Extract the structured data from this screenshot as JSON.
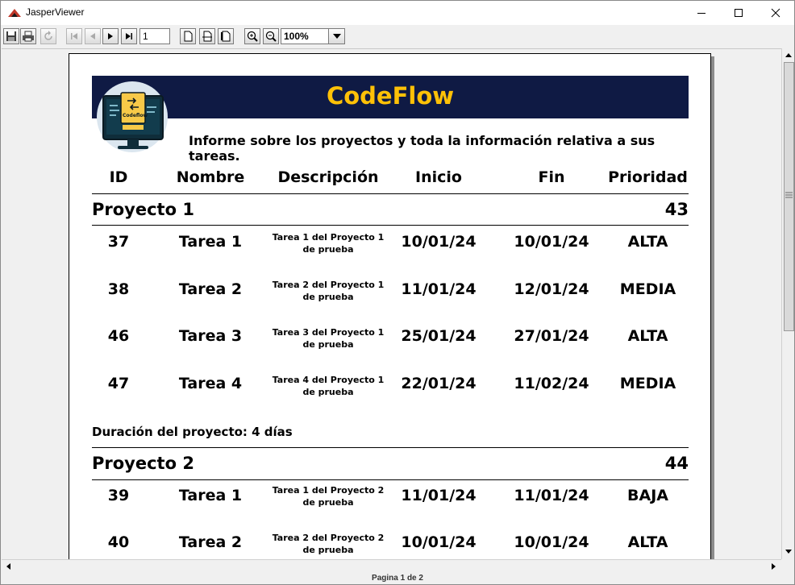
{
  "window": {
    "title": "JasperViewer"
  },
  "toolbar": {
    "page_number": "1",
    "zoom": "100%"
  },
  "status": {
    "page_label": "Pagina 1 de 2"
  },
  "report": {
    "brand": "CodeFlow",
    "logo_text": "Codeflow",
    "subtitle": "Informe sobre los proyectos y toda la información relativa a sus tareas.",
    "columns": [
      "ID",
      "Nombre",
      "Descripción",
      "Inicio",
      "Fin",
      "Prioridad"
    ],
    "projects": [
      {
        "name": "Proyecto 1",
        "id": "43",
        "duration": "Duración del proyecto: 4 días",
        "tasks": [
          {
            "id": "37",
            "name": "Tarea 1",
            "desc1": "Tarea 1 del Proyecto 1",
            "desc2": "de prueba",
            "start": "10/01/24",
            "end": "10/01/24",
            "priority": "ALTA"
          },
          {
            "id": "38",
            "name": "Tarea 2",
            "desc1": "Tarea 2 del Proyecto 1",
            "desc2": "de prueba",
            "start": "11/01/24",
            "end": "12/01/24",
            "priority": "MEDIA"
          },
          {
            "id": "46",
            "name": "Tarea 3",
            "desc1": "Tarea 3 del Proyecto 1",
            "desc2": "de prueba",
            "start": "25/01/24",
            "end": "27/01/24",
            "priority": "ALTA"
          },
          {
            "id": "47",
            "name": "Tarea 4",
            "desc1": "Tarea 4 del Proyecto 1",
            "desc2": "de prueba",
            "start": "22/01/24",
            "end": "11/02/24",
            "priority": "MEDIA"
          }
        ]
      },
      {
        "name": "Proyecto 2",
        "id": "44",
        "tasks": [
          {
            "id": "39",
            "name": "Tarea 1",
            "desc1": "Tarea 1 del Proyecto 2",
            "desc2": "de prueba",
            "start": "11/01/24",
            "end": "11/01/24",
            "priority": "BAJA"
          },
          {
            "id": "40",
            "name": "Tarea 2",
            "desc1": "Tarea 2 del Proyecto 2",
            "desc2": "de prueba",
            "start": "10/01/24",
            "end": "10/01/24",
            "priority": "ALTA"
          }
        ]
      }
    ]
  }
}
